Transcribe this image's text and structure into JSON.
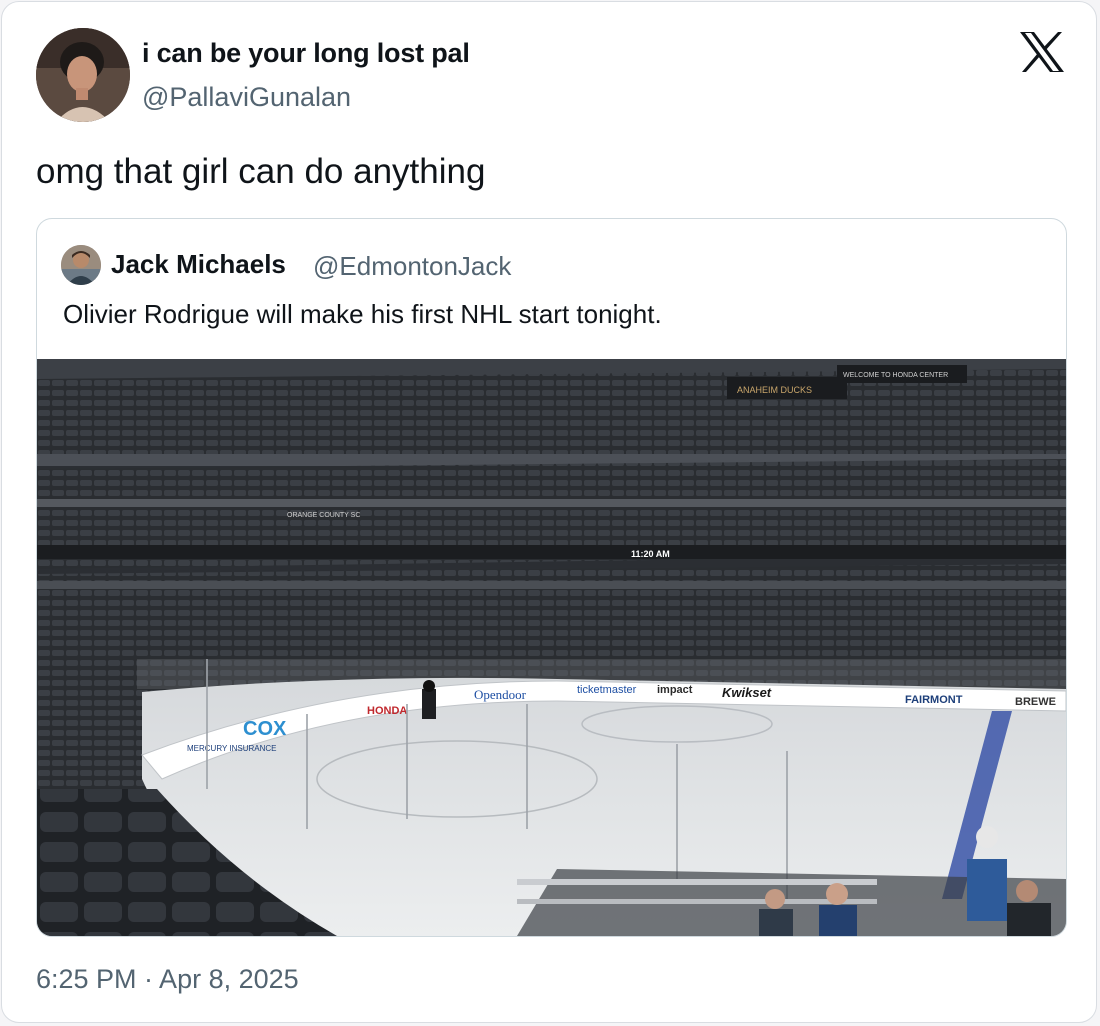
{
  "tweet": {
    "author_name": "i can be your long lost pal",
    "author_handle": "@PallaviGunalan",
    "text": "omg that girl can do anything",
    "timestamp": "6:25 PM · Apr 8, 2025",
    "platform_icon": "x-logo-icon"
  },
  "quoted_tweet": {
    "author_name": "Jack Michaels",
    "author_handle": "@EdmontonJack",
    "text": "Olivier Rodrigue will make his first NHL start tonight.",
    "media": {
      "scoreboard_time": "11:20 AM",
      "signs": {
        "opendoor": "Opendoor",
        "ticketmaster": "ticketmaster",
        "impact": "impact",
        "kwikset": "Kwikset",
        "fairmont": "FAIRMONT",
        "brewe": "BREWE",
        "cox": "COX",
        "honda": "HONDA",
        "mercury": "MERCURY INSURANCE",
        "ducks": "ANAHEIM DUCKS",
        "welcome": "WELCOME TO HONDA CENTER",
        "orange_county": "ORANGE COUNTY SC"
      }
    }
  },
  "colors": {
    "text_primary": "#0f1419",
    "text_secondary": "#536471",
    "border": "#cfd9de"
  }
}
